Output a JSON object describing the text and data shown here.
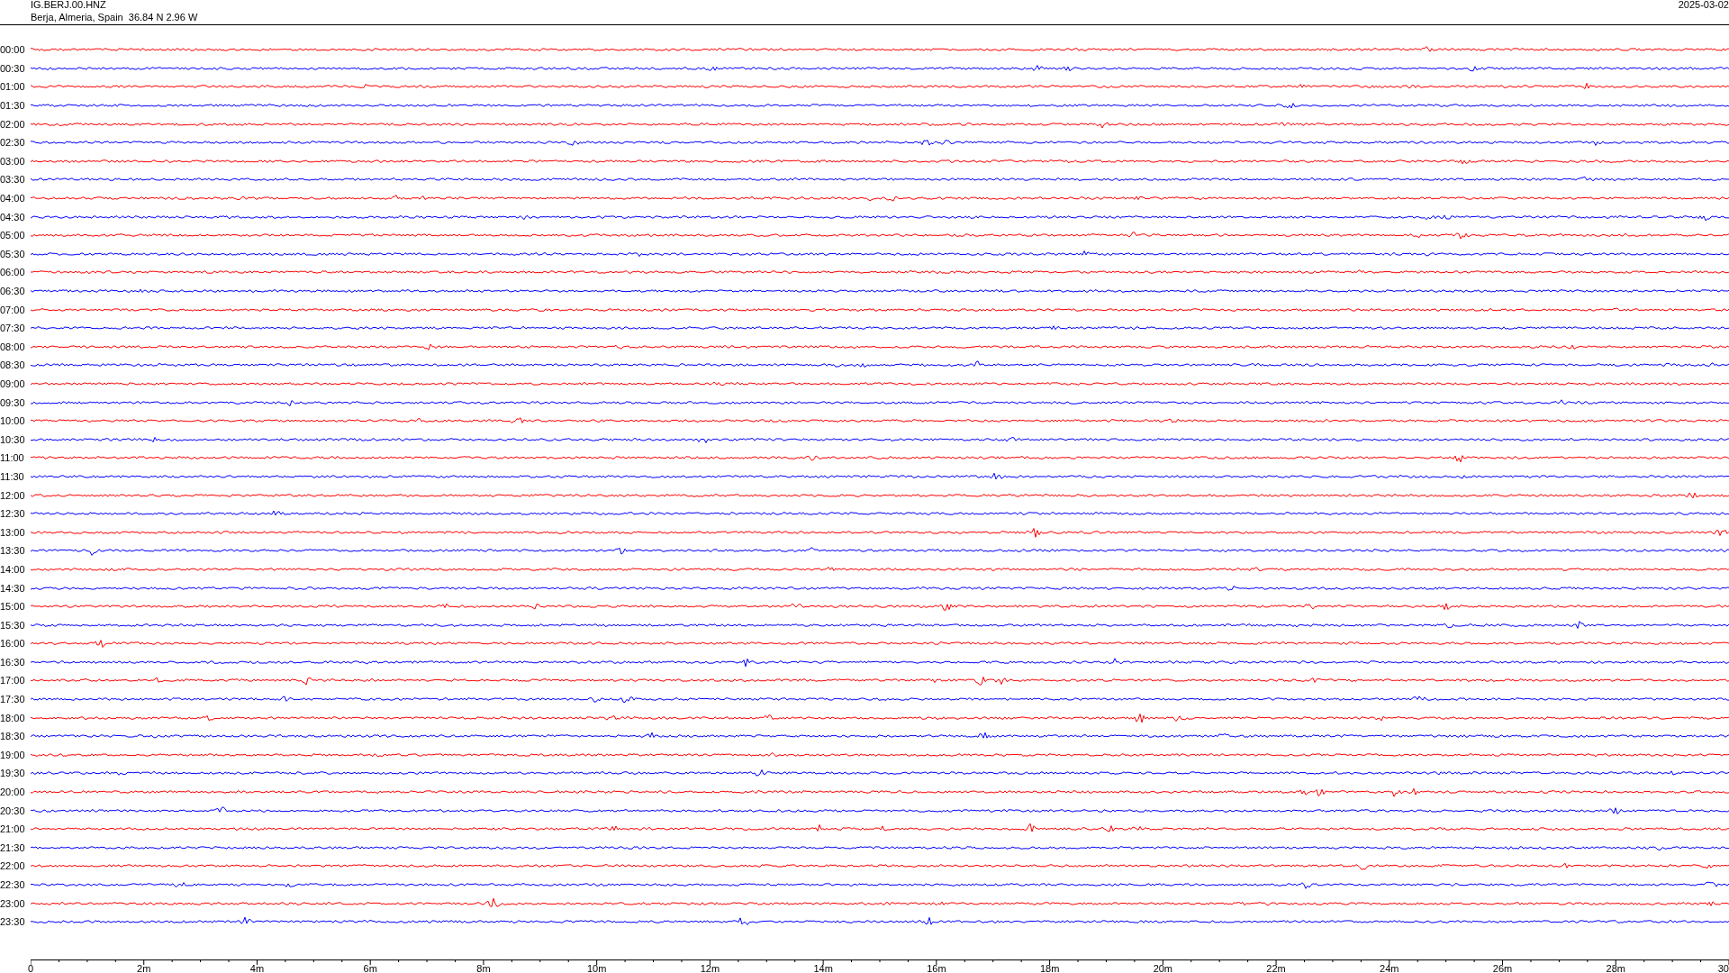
{
  "header": {
    "station": "IG.BERJ.00.HNZ",
    "location": "Berja, Almeria, Spain  36.84 N 2.96 W",
    "date": "2025-03-02"
  },
  "rows": [
    {
      "label": "00:00",
      "color": "#ff0000"
    },
    {
      "label": "00:30",
      "color": "#0000ff"
    },
    {
      "label": "01:00",
      "color": "#ff0000"
    },
    {
      "label": "01:30",
      "color": "#0000ff"
    },
    {
      "label": "02:00",
      "color": "#ff0000"
    },
    {
      "label": "02:30",
      "color": "#0000ff"
    },
    {
      "label": "03:00",
      "color": "#ff0000"
    },
    {
      "label": "03:30",
      "color": "#0000ff"
    },
    {
      "label": "04:00",
      "color": "#ff0000"
    },
    {
      "label": "04:30",
      "color": "#0000ff"
    },
    {
      "label": "05:00",
      "color": "#ff0000"
    },
    {
      "label": "05:30",
      "color": "#0000ff"
    },
    {
      "label": "06:00",
      "color": "#ff0000"
    },
    {
      "label": "06:30",
      "color": "#0000ff"
    },
    {
      "label": "07:00",
      "color": "#ff0000"
    },
    {
      "label": "07:30",
      "color": "#0000ff"
    },
    {
      "label": "08:00",
      "color": "#ff0000"
    },
    {
      "label": "08:30",
      "color": "#0000ff"
    },
    {
      "label": "09:00",
      "color": "#ff0000"
    },
    {
      "label": "09:30",
      "color": "#0000ff"
    },
    {
      "label": "10:00",
      "color": "#ff0000"
    },
    {
      "label": "10:30",
      "color": "#0000ff"
    },
    {
      "label": "11:00",
      "color": "#ff0000"
    },
    {
      "label": "11:30",
      "color": "#0000ff"
    },
    {
      "label": "12:00",
      "color": "#ff0000"
    },
    {
      "label": "12:30",
      "color": "#0000ff"
    },
    {
      "label": "13:00",
      "color": "#ff0000"
    },
    {
      "label": "13:30",
      "color": "#0000ff"
    },
    {
      "label": "14:00",
      "color": "#ff0000"
    },
    {
      "label": "14:30",
      "color": "#0000ff"
    },
    {
      "label": "15:00",
      "color": "#ff0000"
    },
    {
      "label": "15:30",
      "color": "#0000ff"
    },
    {
      "label": "16:00",
      "color": "#ff0000"
    },
    {
      "label": "16:30",
      "color": "#0000ff"
    },
    {
      "label": "17:00",
      "color": "#ff0000"
    },
    {
      "label": "17:30",
      "color": "#0000ff"
    },
    {
      "label": "18:00",
      "color": "#ff0000"
    },
    {
      "label": "18:30",
      "color": "#0000ff"
    },
    {
      "label": "19:00",
      "color": "#ff0000"
    },
    {
      "label": "19:30",
      "color": "#0000ff"
    },
    {
      "label": "20:00",
      "color": "#ff0000"
    },
    {
      "label": "20:30",
      "color": "#0000ff"
    },
    {
      "label": "21:00",
      "color": "#ff0000"
    },
    {
      "label": "21:30",
      "color": "#0000ff"
    },
    {
      "label": "22:00",
      "color": "#ff0000"
    },
    {
      "label": "22:30",
      "color": "#0000ff"
    },
    {
      "label": "23:00",
      "color": "#ff0000"
    },
    {
      "label": "23:30",
      "color": "#0000ff"
    }
  ],
  "x_axis": {
    "labels": [
      "0",
      "2m",
      "4m",
      "6m",
      "8m",
      "10m",
      "12m",
      "14m",
      "16m",
      "18m",
      "20m",
      "22m",
      "24m",
      "26m",
      "28m",
      "30"
    ]
  }
}
